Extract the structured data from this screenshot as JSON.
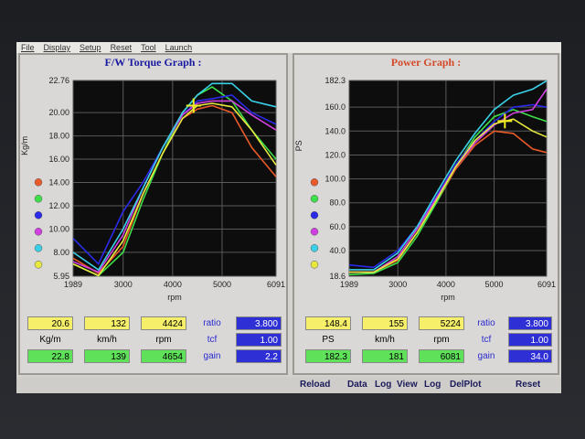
{
  "menu": [
    "File",
    "Display",
    "Setup",
    "Reset",
    "Tool",
    "Launch"
  ],
  "torque": {
    "title": "F/W Torque Graph :",
    "ylabel": "Kg/m",
    "xlabel": "rpm",
    "yticks": [
      "22.76",
      "20.00",
      "18.00",
      "16.00",
      "14.00",
      "12.00",
      "10.00",
      "8.00",
      "5.95"
    ],
    "xticks": [
      "1989",
      "3000",
      "4000",
      "5000",
      "6091"
    ],
    "readouts": {
      "row1": [
        "20.6",
        "132",
        "4424"
      ],
      "units": [
        "Kg/m",
        "km/h",
        "rpm"
      ],
      "row2": [
        "22.8",
        "139",
        "4654"
      ],
      "ratio_label": "ratio",
      "ratio": "3.800",
      "tcf_label": "tcf",
      "tcf": "1.00",
      "gain_label": "gain",
      "gain": "2.2"
    }
  },
  "power": {
    "title": "Power Graph :",
    "ylabel": "PS",
    "xlabel": "rpm",
    "yticks": [
      "182.3",
      "160.0",
      "140.0",
      "120.0",
      "100.0",
      "80.0",
      "60.0",
      "40.0",
      "18.6"
    ],
    "xticks": [
      "1989",
      "3000",
      "4000",
      "5000",
      "6091"
    ],
    "readouts": {
      "row1": [
        "148.4",
        "155",
        "5224"
      ],
      "units": [
        "PS",
        "km/h",
        "rpm"
      ],
      "row2": [
        "182.3",
        "181",
        "6081"
      ],
      "ratio_label": "ratio",
      "ratio": "3.800",
      "tcf_label": "tcf",
      "tcf": "1.00",
      "gain_label": "gain",
      "gain": "34.0"
    }
  },
  "bottom_menu": [
    "Reload",
    "Data",
    "Log",
    "View",
    "Log",
    "DelPlot",
    "Reset"
  ],
  "colors": {
    "series": [
      "#e85a2a",
      "#3ee04a",
      "#2a2ae8",
      "#d040e0",
      "#3ad0e8",
      "#e8e840"
    ]
  },
  "chart_data": [
    {
      "type": "line",
      "title": "F/W Torque Graph :",
      "xlabel": "rpm",
      "ylabel": "Kg/m",
      "xlim": [
        1989,
        6091
      ],
      "ylim": [
        5.95,
        22.76
      ],
      "grid": true,
      "series": [
        {
          "color": "#e85a2a",
          "x": [
            1989,
            2500,
            3000,
            3400,
            3800,
            4200,
            4500,
            4800,
            5200,
            5600,
            6091
          ],
          "y": [
            7.5,
            6.2,
            8.5,
            13.0,
            16.5,
            19.5,
            20.3,
            20.6,
            20.0,
            17.0,
            14.5
          ]
        },
        {
          "color": "#3ee04a",
          "x": [
            1989,
            2500,
            3000,
            3400,
            3800,
            4200,
            4500,
            4800,
            5200,
            5600,
            6091
          ],
          "y": [
            7.0,
            6.0,
            8.0,
            12.5,
            16.5,
            20.0,
            21.5,
            22.2,
            21.0,
            18.5,
            16.0
          ]
        },
        {
          "color": "#2a2ae8",
          "x": [
            1989,
            2500,
            3000,
            3400,
            3800,
            4200,
            4500,
            4800,
            5200,
            5600,
            6091
          ],
          "y": [
            9.2,
            7.0,
            11.5,
            14.0,
            17.0,
            19.8,
            21.0,
            21.2,
            21.5,
            20.0,
            19.0
          ]
        },
        {
          "color": "#d040e0",
          "x": [
            1989,
            2500,
            3000,
            3400,
            3800,
            4200,
            4500,
            4800,
            5200,
            5600,
            6091
          ],
          "y": [
            7.2,
            6.3,
            9.5,
            13.5,
            17.0,
            19.8,
            20.8,
            21.0,
            21.0,
            19.8,
            18.5
          ]
        },
        {
          "color": "#3ad0e8",
          "x": [
            1989,
            2500,
            3000,
            3400,
            3800,
            4200,
            4500,
            4800,
            5200,
            5600,
            6091
          ],
          "y": [
            8.0,
            6.5,
            10.0,
            13.5,
            17.0,
            20.0,
            21.5,
            22.5,
            22.5,
            21.0,
            20.5
          ]
        },
        {
          "color": "#e8e840",
          "x": [
            1989,
            2500,
            3000,
            3400,
            3800,
            4200,
            4500,
            4800,
            5200,
            5600,
            6091
          ],
          "y": [
            7.0,
            6.0,
            9.0,
            13.0,
            16.5,
            19.5,
            20.6,
            20.8,
            20.5,
            18.5,
            15.5
          ]
        }
      ],
      "cursor": {
        "x": 4424,
        "y": 20.6
      }
    },
    {
      "type": "line",
      "title": "Power Graph :",
      "xlabel": "rpm",
      "ylabel": "PS",
      "xlim": [
        1989,
        6091
      ],
      "ylim": [
        18.6,
        182.3
      ],
      "grid": true,
      "series": [
        {
          "color": "#e85a2a",
          "x": [
            1989,
            2500,
            3000,
            3400,
            3800,
            4200,
            4600,
            5000,
            5400,
            5800,
            6091
          ],
          "y": [
            22,
            22,
            32,
            55,
            80,
            108,
            128,
            140,
            138,
            125,
            122
          ]
        },
        {
          "color": "#3ee04a",
          "x": [
            1989,
            2500,
            3000,
            3400,
            3800,
            4200,
            4600,
            5000,
            5400,
            5800,
            6091
          ],
          "y": [
            20,
            21,
            30,
            52,
            80,
            110,
            135,
            152,
            158,
            152,
            148
          ]
        },
        {
          "color": "#2a2ae8",
          "x": [
            1989,
            2500,
            3000,
            3400,
            3800,
            4200,
            4600,
            5000,
            5400,
            5800,
            6091
          ],
          "y": [
            28,
            26,
            40,
            60,
            85,
            112,
            132,
            148,
            160,
            162,
            160
          ]
        },
        {
          "color": "#d040e0",
          "x": [
            1989,
            2500,
            3000,
            3400,
            3800,
            4200,
            4600,
            5000,
            5400,
            5800,
            6091
          ],
          "y": [
            22,
            22,
            35,
            58,
            84,
            110,
            130,
            145,
            155,
            158,
            175
          ]
        },
        {
          "color": "#3ad0e8",
          "x": [
            1989,
            2500,
            3000,
            3400,
            3800,
            4200,
            4600,
            5000,
            5400,
            5800,
            6091
          ],
          "y": [
            24,
            24,
            38,
            60,
            88,
            115,
            138,
            158,
            170,
            175,
            182
          ]
        },
        {
          "color": "#e8e840",
          "x": [
            1989,
            2500,
            3000,
            3400,
            3800,
            4200,
            4600,
            5000,
            5400,
            5800,
            6091
          ],
          "y": [
            22,
            22,
            33,
            55,
            82,
            110,
            132,
            146,
            150,
            140,
            135
          ]
        }
      ],
      "cursor": {
        "x": 5224,
        "y": 148.4
      }
    }
  ]
}
